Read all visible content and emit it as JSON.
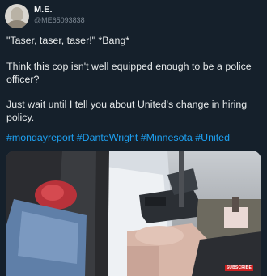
{
  "user": {
    "name": "M.E.",
    "handle": "@ME65093838"
  },
  "tweet": {
    "line1": "\"Taser, taser, taser!\" *Bang*",
    "line2": "Think this cop isn't well equipped enough to be a police officer?",
    "line3": "Just wait until I tell you about United's change in hiring policy.",
    "hashtags": "#mondayreport #DanteWright #Minnesota #United"
  },
  "media": {
    "badge": "SUBSCRIBE",
    "icon": "video-still"
  },
  "colors": {
    "background": "#15202b",
    "text": "#e6e9ea",
    "link": "#1da1f2",
    "handle": "#7f8a95",
    "badge": "#cc1f1f"
  }
}
